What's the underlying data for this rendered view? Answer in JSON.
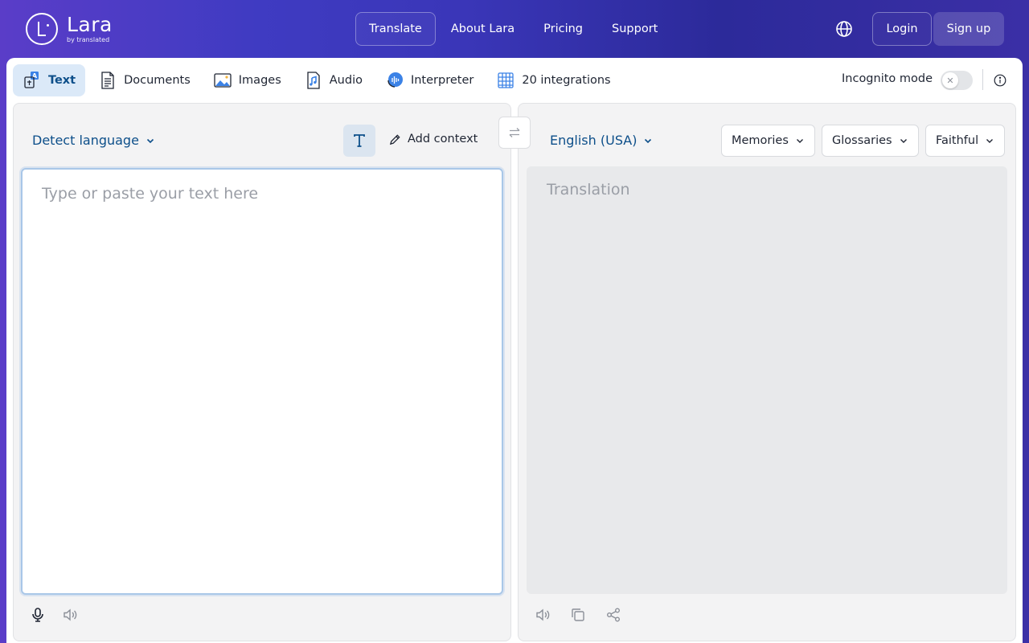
{
  "brand": {
    "name": "Lara",
    "sub": "by translated"
  },
  "nav": {
    "items": [
      "Translate",
      "About Lara",
      "Pricing",
      "Support"
    ],
    "login": "Login",
    "signup": "Sign up"
  },
  "tabs": [
    {
      "label": "Text",
      "icon": "text-translate-icon"
    },
    {
      "label": "Documents",
      "icon": "document-icon"
    },
    {
      "label": "Images",
      "icon": "image-icon"
    },
    {
      "label": "Audio",
      "icon": "audio-file-icon"
    },
    {
      "label": "Interpreter",
      "icon": "interpreter-icon"
    },
    {
      "label": "20 integrations",
      "icon": "integrations-icon"
    }
  ],
  "incognito": {
    "label": "Incognito mode",
    "enabled": false
  },
  "source": {
    "language": "Detect language",
    "add_context": "Add context",
    "placeholder": "Type or paste your text here"
  },
  "target": {
    "language": "English (USA)",
    "memories": "Memories",
    "glossaries": "Glossaries",
    "style": "Faithful",
    "placeholder": "Translation"
  },
  "colors": {
    "accent": "#0d4f8a",
    "active_tab_bg": "#dbe9f8"
  }
}
